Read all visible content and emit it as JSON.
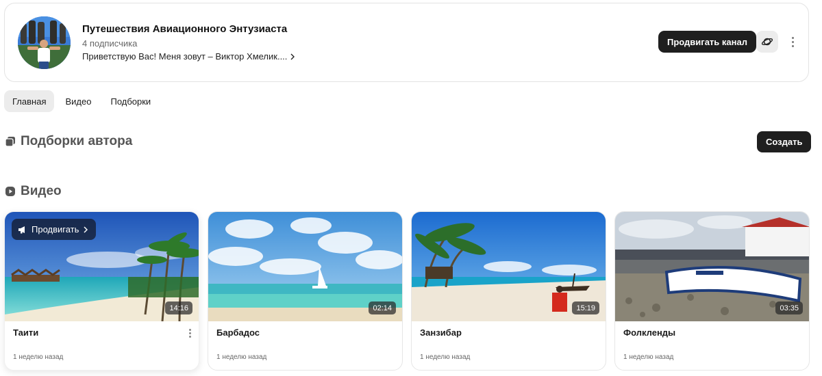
{
  "channel": {
    "title": "Путешествия Авиационного Энтузиаста",
    "subscribers": "4 подписчика",
    "description": "Приветствую Вас! Меня зовут – Виктор Хмелик....",
    "promote_label": "Продвигать канал",
    "avatar_icon": "avatar",
    "planet_icon": "planet-icon",
    "more_icon": "more-vertical-icon"
  },
  "tabs": [
    {
      "label": "Главная",
      "active": true
    },
    {
      "label": "Видео",
      "active": false
    },
    {
      "label": "Подборки",
      "active": false
    }
  ],
  "collections_section": {
    "title": "Подборки автора",
    "icon": "collections-icon",
    "create_label": "Создать"
  },
  "video_section": {
    "title": "Видео",
    "icon": "video-icon"
  },
  "videos": [
    {
      "title": "Таити",
      "duration": "14:16",
      "date": "1 неделю назад",
      "promote_label": "Продвигать"
    },
    {
      "title": "Барбадос",
      "duration": "02:14",
      "date": "1 неделю назад"
    },
    {
      "title": "Занзибар",
      "duration": "15:19",
      "date": "1 неделю назад"
    },
    {
      "title": "Фолкленды",
      "duration": "03:35",
      "date": "1 неделю назад"
    }
  ],
  "colors": {
    "primary_button": "#1f1f1f",
    "tab_active_bg": "#ececec",
    "border": "#e3e3e3",
    "section_title": "#555555"
  }
}
